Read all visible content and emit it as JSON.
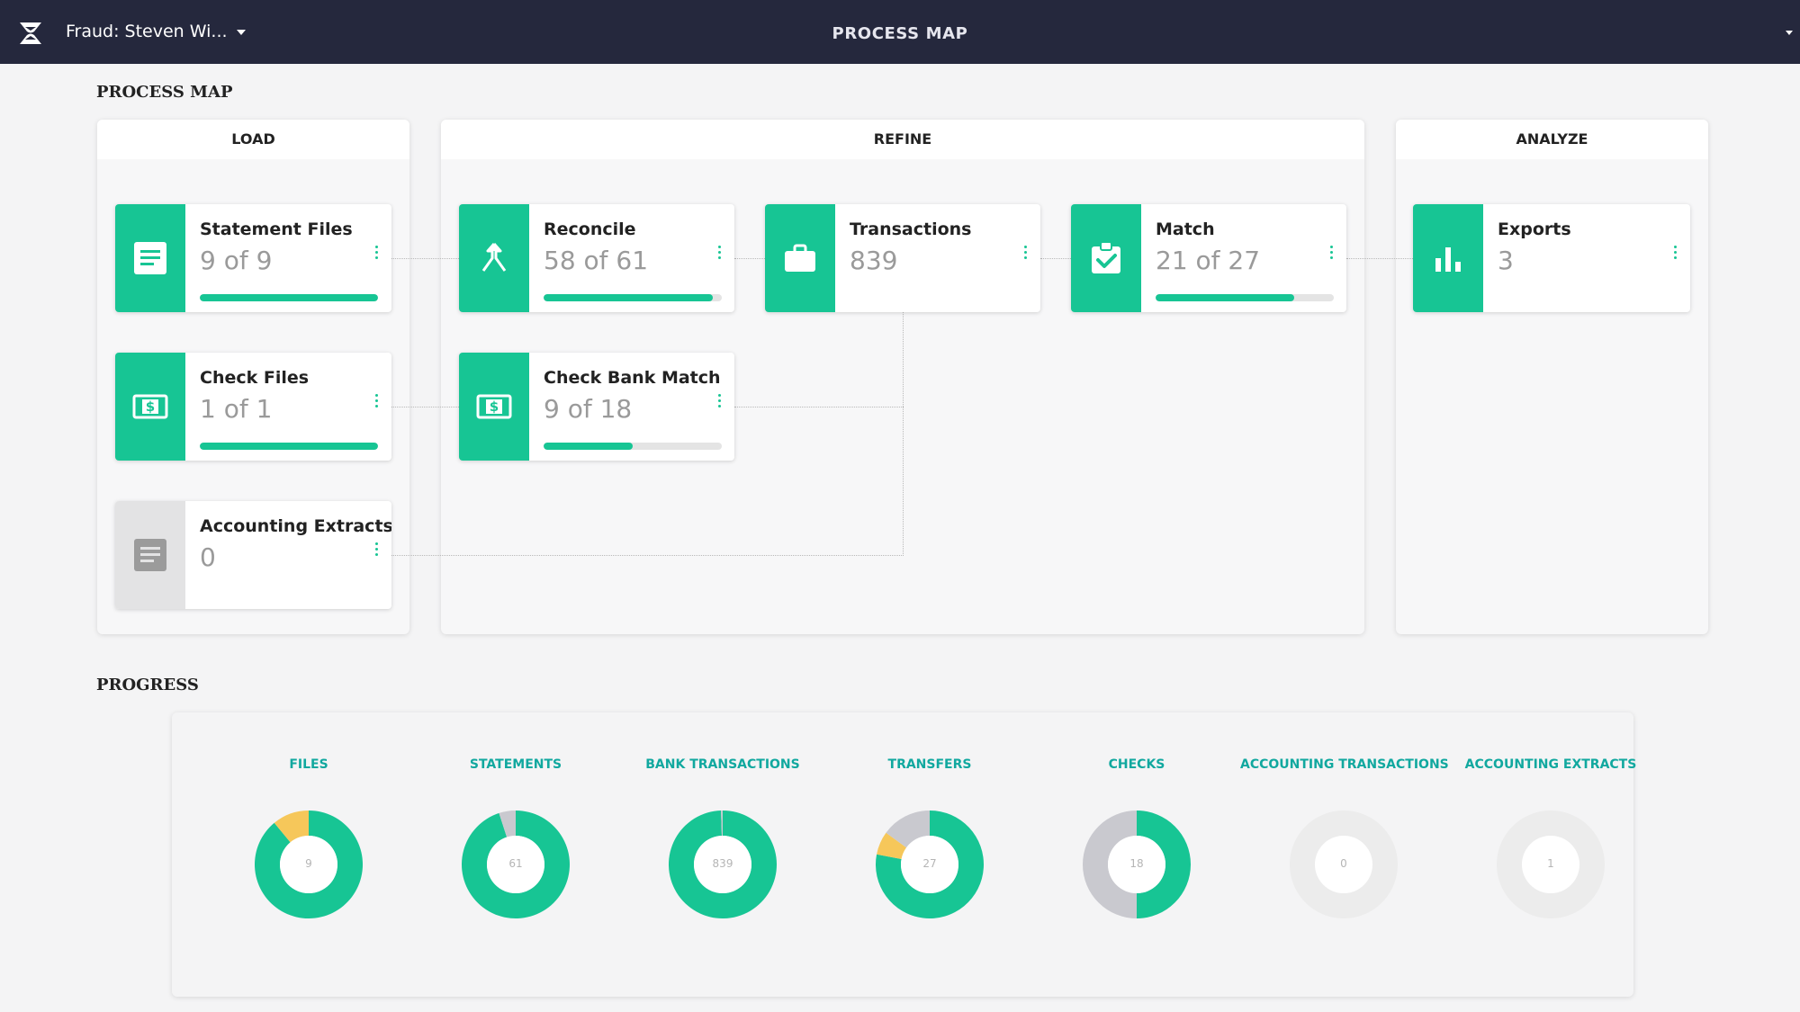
{
  "topbar": {
    "case_title": "Fraud: Steven Wi...",
    "center_title": "PROCESS MAP",
    "icons": {
      "logo": "app-logo-icon",
      "case_dropdown": "caret-down-icon",
      "user_menu": "caret-down-icon"
    }
  },
  "process_map": {
    "title": "PROCESS MAP",
    "columns": [
      {
        "name": "LOAD"
      },
      {
        "name": "REFINE"
      },
      {
        "name": "ANALYZE"
      }
    ],
    "cards": [
      {
        "id": "statement-files",
        "title": "Statement Files",
        "count": "9 of 9",
        "icon": "document-icon",
        "progress": 1.0,
        "active": true
      },
      {
        "id": "check-files",
        "title": "Check Files",
        "count": "1 of 1",
        "icon": "dollar-bill-icon",
        "progress": 1.0,
        "active": true
      },
      {
        "id": "accounting-extracts",
        "title": "Accounting Extracts",
        "count": "0",
        "icon": "document-icon",
        "progress": null,
        "active": false
      },
      {
        "id": "reconcile",
        "title": "Reconcile",
        "count": "58 of 61",
        "icon": "merge-icon",
        "progress": 0.95,
        "active": true
      },
      {
        "id": "check-bank-match",
        "title": "Check Bank Match",
        "count": "9 of 18",
        "icon": "dollar-bill-icon",
        "progress": 0.5,
        "active": true
      },
      {
        "id": "transactions",
        "title": "Transactions",
        "count": "839",
        "icon": "briefcase-icon",
        "progress": null,
        "active": true
      },
      {
        "id": "match",
        "title": "Match",
        "count": "21 of 27",
        "icon": "clipboard-check-icon",
        "progress": 0.78,
        "active": true
      },
      {
        "id": "exports",
        "title": "Exports",
        "count": "3",
        "icon": "bar-chart-icon",
        "progress": null,
        "active": true
      }
    ]
  },
  "progress": {
    "title": "PROGRESS",
    "colors": {
      "complete": "#17c594",
      "pending": "#f6c75a",
      "unmatched": "#c9c9cf",
      "empty": "#ececec"
    },
    "donuts": [
      {
        "label": "FILES",
        "total": "9",
        "segments": [
          {
            "color": "#17c594",
            "fraction": 0.89
          },
          {
            "color": "#f6c75a",
            "fraction": 0.11
          }
        ]
      },
      {
        "label": "STATEMENTS",
        "total": "61",
        "segments": [
          {
            "color": "#17c594",
            "fraction": 0.95
          },
          {
            "color": "#c9c9cf",
            "fraction": 0.05
          }
        ]
      },
      {
        "label": "BANK TRANSACTIONS",
        "total": "839",
        "segments": [
          {
            "color": "#17c594",
            "fraction": 0.995
          },
          {
            "color": "#c9c9cf",
            "fraction": 0.005
          }
        ]
      },
      {
        "label": "TRANSFERS",
        "total": "27",
        "segments": [
          {
            "color": "#17c594",
            "fraction": 0.78
          },
          {
            "color": "#f6c75a",
            "fraction": 0.07
          },
          {
            "color": "#c9c9cf",
            "fraction": 0.15
          }
        ]
      },
      {
        "label": "CHECKS",
        "total": "18",
        "segments": [
          {
            "color": "#17c594",
            "fraction": 0.5
          },
          {
            "color": "#c9c9cf",
            "fraction": 0.5
          }
        ]
      },
      {
        "label": "ACCOUNTING TRANSACTIONS",
        "total": "0",
        "segments": [
          {
            "color": "#ececec",
            "fraction": 1.0
          }
        ]
      },
      {
        "label": "ACCOUNTING EXTRACTS",
        "total": "1",
        "segments": [
          {
            "color": "#ececec",
            "fraction": 1.0
          }
        ]
      }
    ]
  }
}
